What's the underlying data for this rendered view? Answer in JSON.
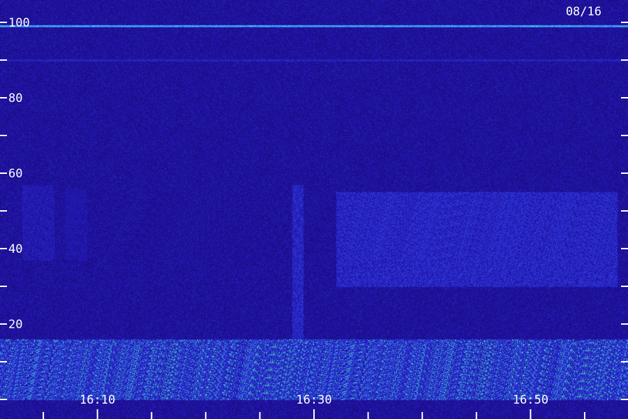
{
  "date_label": "08/16",
  "chart_data": {
    "type": "heatmap",
    "title": "",
    "xlabel": "",
    "ylabel": "",
    "ylim": [
      0,
      100
    ],
    "y_ticks": [
      0,
      10,
      20,
      30,
      40,
      50,
      60,
      70,
      80,
      90,
      100
    ],
    "y_tick_labels": [
      "20",
      "40",
      "60",
      "80",
      "100"
    ],
    "x_range": [
      "16:01",
      "16:59"
    ],
    "x_tick_labels": [
      "16:10",
      "16:30",
      "16:50"
    ],
    "x_minor_ticks": [
      "16:05",
      "16:10",
      "16:15",
      "16:20",
      "16:25",
      "16:30",
      "16:35",
      "16:40",
      "16:45",
      "16:50",
      "16:55"
    ],
    "grid": false,
    "colors": {
      "background": "#14095a",
      "low": "#1f10a0",
      "mid": "#2f3ae0",
      "high": "#3fb0ff",
      "peak": "#40ff90"
    },
    "features": [
      {
        "name": "continuous line",
        "y": 99,
        "time_start": "16:01",
        "time_end": "16:59",
        "intensity": 0.7
      },
      {
        "name": "faint line",
        "y": 90,
        "time_start": "16:01",
        "time_end": "16:59",
        "intensity": 0.35
      },
      {
        "name": "band",
        "y_low": 37,
        "y_high": 57,
        "time_start": "16:03",
        "time_end": "16:06",
        "intensity": 0.45
      },
      {
        "name": "band",
        "y_low": 37,
        "y_high": 56,
        "time_start": "16:07",
        "time_end": "16:09",
        "intensity": 0.4
      },
      {
        "name": "vertical streak",
        "y_low": 15,
        "y_high": 57,
        "time_start": "16:28",
        "time_end": "16:29",
        "intensity": 0.55
      },
      {
        "name": "band",
        "y_low": 30,
        "y_high": 55,
        "time_start": "16:32",
        "time_end": "16:58",
        "intensity": 0.55
      },
      {
        "name": "low-frequency noise",
        "y_low": 0,
        "y_high": 16,
        "time_start": "16:01",
        "time_end": "16:59",
        "intensity": 0.85
      }
    ]
  }
}
